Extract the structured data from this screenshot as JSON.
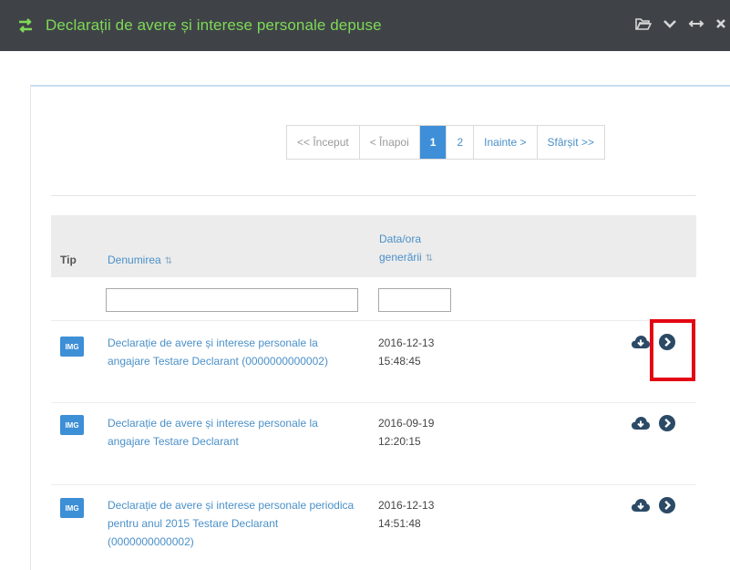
{
  "window": {
    "title": "Declarații de avere și interese personale depuse",
    "icons": [
      "swap-arrows-icon",
      "folder-open-icon",
      "chevron-down-icon",
      "resize-horizontal-icon",
      "close-icon"
    ],
    "accent_color": "#7ed957"
  },
  "pager": {
    "first": "<< Început",
    "prev": "< Înapoi",
    "pages": [
      "1",
      "2"
    ],
    "current_page": "1",
    "next": "Inainte >",
    "last": "Sfârșit >>",
    "active_color": "#3e8fd8"
  },
  "table": {
    "columns": {
      "tip": "Tip",
      "name": "Denumirea",
      "date_line1": "Data/ora",
      "date_line2": "generării",
      "sort_symbol": "⇅"
    },
    "filters": {
      "name_value": "",
      "date_value": ""
    },
    "rows": [
      {
        "type_badge": "IMG",
        "name": "Declarație de avere și interese personale la angajare Testare Declarant (0000000000002)",
        "date": "2016-12-13",
        "time": "15:48:45",
        "actions": [
          "cloud-download-icon",
          "chevron-circle-right-icon"
        ]
      },
      {
        "type_badge": "IMG",
        "name": "Declarație de avere și interese personale la angajare Testare Declarant",
        "date": "2016-09-19",
        "time": "12:20:15",
        "actions": [
          "cloud-download-icon",
          "chevron-circle-right-icon"
        ]
      },
      {
        "type_badge": "IMG",
        "name": "Declarație de avere și interese personale periodica pentru anul 2015 Testare Declarant (0000000000002)",
        "date": "2016-12-13",
        "time": "14:51:48",
        "actions": [
          "cloud-download-icon",
          "chevron-circle-right-icon"
        ]
      }
    ]
  },
  "annotation": {
    "highlight_color": "#e30613"
  }
}
